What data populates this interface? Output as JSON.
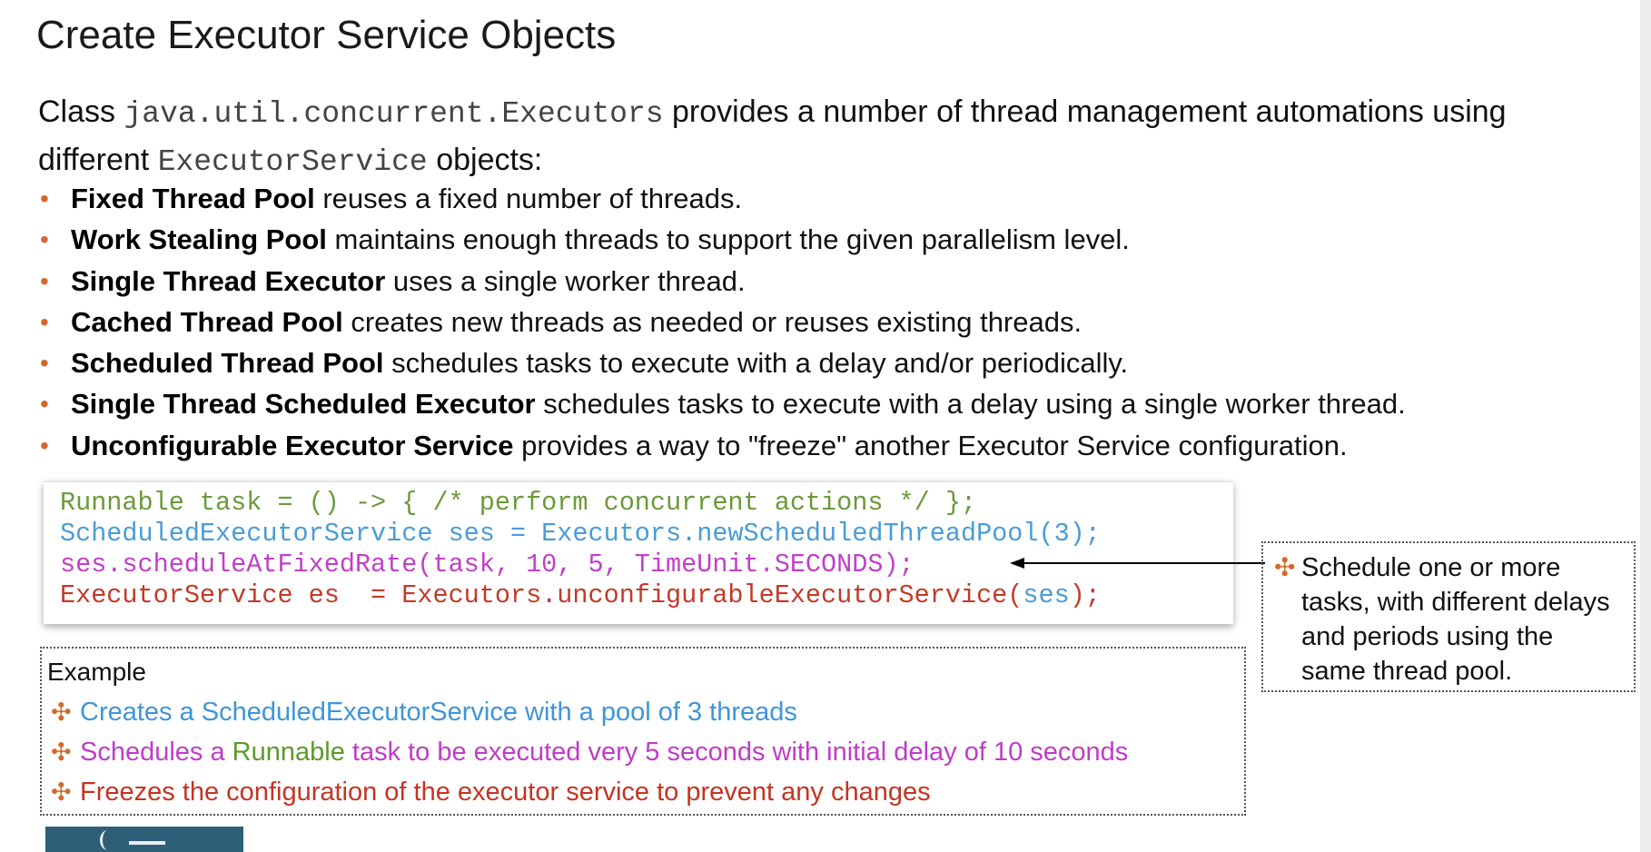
{
  "slide": {
    "title": "Create Executor Service Objects",
    "intro": {
      "text1": "Class ",
      "code1": "java.util.concurrent.Executors",
      "text2": " provides a number of thread management automations using different ",
      "code2": "ExecutorService",
      "text3": " objects:"
    },
    "bullets": [
      {
        "term": "Fixed Thread Pool",
        "desc": " reuses a fixed number of threads."
      },
      {
        "term": "Work Stealing Pool",
        "desc": " maintains enough threads to support the given parallelism level."
      },
      {
        "term": "Single Thread Executor",
        "desc": " uses a single worker thread."
      },
      {
        "term": "Cached Thread Pool",
        "desc": " creates new threads as needed or reuses existing threads."
      },
      {
        "term": "Scheduled Thread Pool",
        "desc": " schedules tasks to execute with a delay and/or periodically."
      },
      {
        "term": "Single Thread Scheduled Executor",
        "desc": " schedules tasks to execute with a delay using a single worker thread."
      },
      {
        "term": "Unconfigurable Executor Service",
        "desc": " provides a way to \"freeze\" another Executor Service configuration."
      }
    ],
    "bullet_marker": "•",
    "code": {
      "line1": "Runnable task = () -> { /* perform concurrent actions */ };",
      "line2": "ScheduledExecutorService ses = Executors.newScheduledThreadPool(3);",
      "line3": "ses.scheduleAtFixedRate(task, 10, 5, TimeUnit.SECONDS);",
      "line4_a": "ExecutorService es  = Executors.unconfigurableExecutorService(",
      "line4_b": "ses",
      "line4_c": ");"
    },
    "note": {
      "marker": "✣",
      "text": "Schedule one or more tasks, with different delays and periods using the same thread pool."
    },
    "example": {
      "title": "Example",
      "marker": "✣",
      "line1": "Creates a ScheduledExecutorService with a pool of 3 threads",
      "line2_a": "Schedules a ",
      "line2_b": "Runnable",
      "line2_c": " task to be executed very 5 seconds with initial delay of 10 seconds",
      "line3": "Freezes the configuration of the executor service to prevent any changes"
    },
    "colors": {
      "bullet_accent": "#d4682c",
      "code_green": "#6a9a3a",
      "code_blue": "#4a9cd6",
      "code_magenta": "#c040c8",
      "code_red": "#c23b2a"
    }
  }
}
